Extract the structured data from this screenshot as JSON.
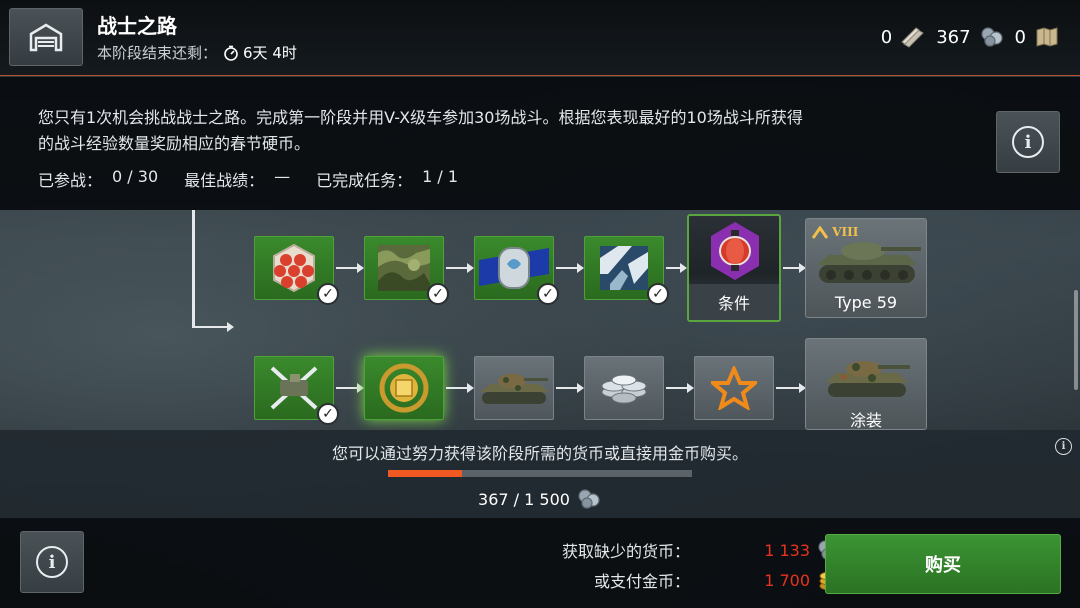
{
  "header": {
    "title": "战士之路",
    "subtitle_label": "本阶段结束还剩：",
    "time_remaining": "6天 4时"
  },
  "currencies": [
    {
      "value": "0",
      "icon": "bond-scroll-icon"
    },
    {
      "value": "367",
      "icon": "festive-coin-icon"
    },
    {
      "value": "0",
      "icon": "map-scroll-icon"
    }
  ],
  "description": {
    "line1": "您只有1次机会挑战战士之路。完成第一阶段并用V-X级车参加30场战斗。根据您表现最好的10场战斗所获得",
    "line2": "的战斗经验数量奖励相应的春节硬币。",
    "stats": {
      "battles_label": "已参战：",
      "battles_value": "0 / 30",
      "best_label": "最佳战绩：",
      "best_value": "—",
      "tasks_label": "已完成任务：",
      "tasks_value": "1 / 1"
    }
  },
  "tree": {
    "row1": [
      {
        "name": "hex-armor-icon",
        "state": "completed"
      },
      {
        "name": "camouflage-icon",
        "state": "completed"
      },
      {
        "name": "dog-tag-icon",
        "state": "completed"
      },
      {
        "name": "emblem-icon",
        "state": "completed"
      }
    ],
    "condition_label": "条件",
    "reward_tank": {
      "tier": "VIII",
      "name": "Type 59"
    },
    "row2": [
      {
        "name": "crossed-tools-icon",
        "state": "completed"
      },
      {
        "name": "gold-emblem-icon",
        "state": "active"
      },
      {
        "name": "tank-camo-icon",
        "state": "locked"
      },
      {
        "name": "silver-coins-icon",
        "state": "locked"
      },
      {
        "name": "star-icon",
        "state": "locked"
      }
    ],
    "reward_camo_label": "涂装"
  },
  "progress": {
    "text": "您可以通过努力获得该阶段所需的货币或直接用金币购买。",
    "current": 367,
    "total": 1500,
    "count_text": "367 / 1 500",
    "fill_color": "#f05a22"
  },
  "purchase": {
    "missing_label": "获取缺少的货币：",
    "missing_value": "1 133",
    "gold_label": "或支付金币：",
    "gold_value": "1 700",
    "buy_label": "购买"
  },
  "colors": {
    "accent_orange": "#b5522c",
    "cost_red": "#e8331e",
    "buy_green": "#3c9433"
  }
}
